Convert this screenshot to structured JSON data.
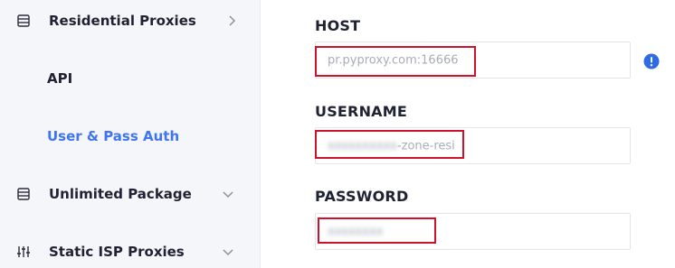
{
  "sidebar": {
    "items": [
      {
        "label": "Residential Proxies",
        "icon": "list-icon",
        "chevron": "chevron-right-icon"
      },
      {
        "label": "Unlimited Package",
        "icon": "list-icon",
        "chevron": "chevron-down-icon"
      },
      {
        "label": "Static ISP Proxies",
        "icon": "sliders-icon",
        "chevron": "chevron-down-icon"
      }
    ],
    "subitems": [
      {
        "label": "API"
      },
      {
        "label": "User & Pass Auth",
        "active": true
      }
    ]
  },
  "fields": {
    "host": {
      "label": "HOST",
      "value": "pr.pyproxy.com:16666"
    },
    "username": {
      "label": "USERNAME",
      "value_suffix": "-zone-resi"
    },
    "password": {
      "label": "PASSWORD"
    }
  },
  "colors": {
    "accent": "#3f74f2",
    "highlight_border": "#d0112b",
    "info_icon": "#2f6be6",
    "sidebar_bg": "#f5f6fa"
  }
}
